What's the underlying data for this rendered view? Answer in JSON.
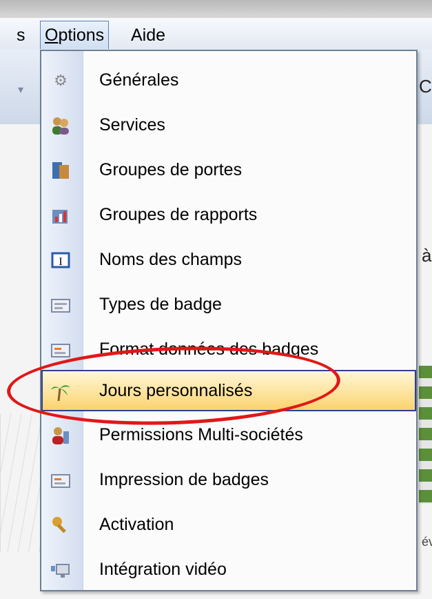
{
  "menubar": {
    "prev_label_tail": "s",
    "options_label": "Options",
    "options_accel": "O",
    "aide_label": "Aide"
  },
  "background": {
    "right_text_top": "CI",
    "right_glyph": "à",
    "right_text_bottom": "év"
  },
  "dropdown": {
    "items": [
      {
        "label": "Générales",
        "icon": "gears-icon"
      },
      {
        "label": "Services",
        "icon": "users-icon"
      },
      {
        "label": "Groupes de portes",
        "icon": "doors-icon"
      },
      {
        "label": "Groupes de rapports",
        "icon": "report-chart-icon"
      },
      {
        "label": "Noms des champs",
        "icon": "text-field-icon"
      },
      {
        "label": "Types de badge",
        "icon": "badge-icon"
      },
      {
        "label": "Format données des badges",
        "icon": "badge-format-icon"
      },
      {
        "label": "Jours personnalisés",
        "icon": "palm-tree-icon",
        "highlighted": true
      },
      {
        "label": "Permissions Multi-sociétés",
        "icon": "user-permissions-icon"
      },
      {
        "label": "Impression de badges",
        "icon": "badge-print-icon"
      },
      {
        "label": "Activation",
        "icon": "key-icon"
      },
      {
        "label": "Intégration vidéo",
        "icon": "video-monitor-icon"
      }
    ]
  },
  "colors": {
    "highlight_top": "#fff7d8",
    "highlight_bottom": "#fbd36e",
    "annotation_red": "#e01818"
  }
}
